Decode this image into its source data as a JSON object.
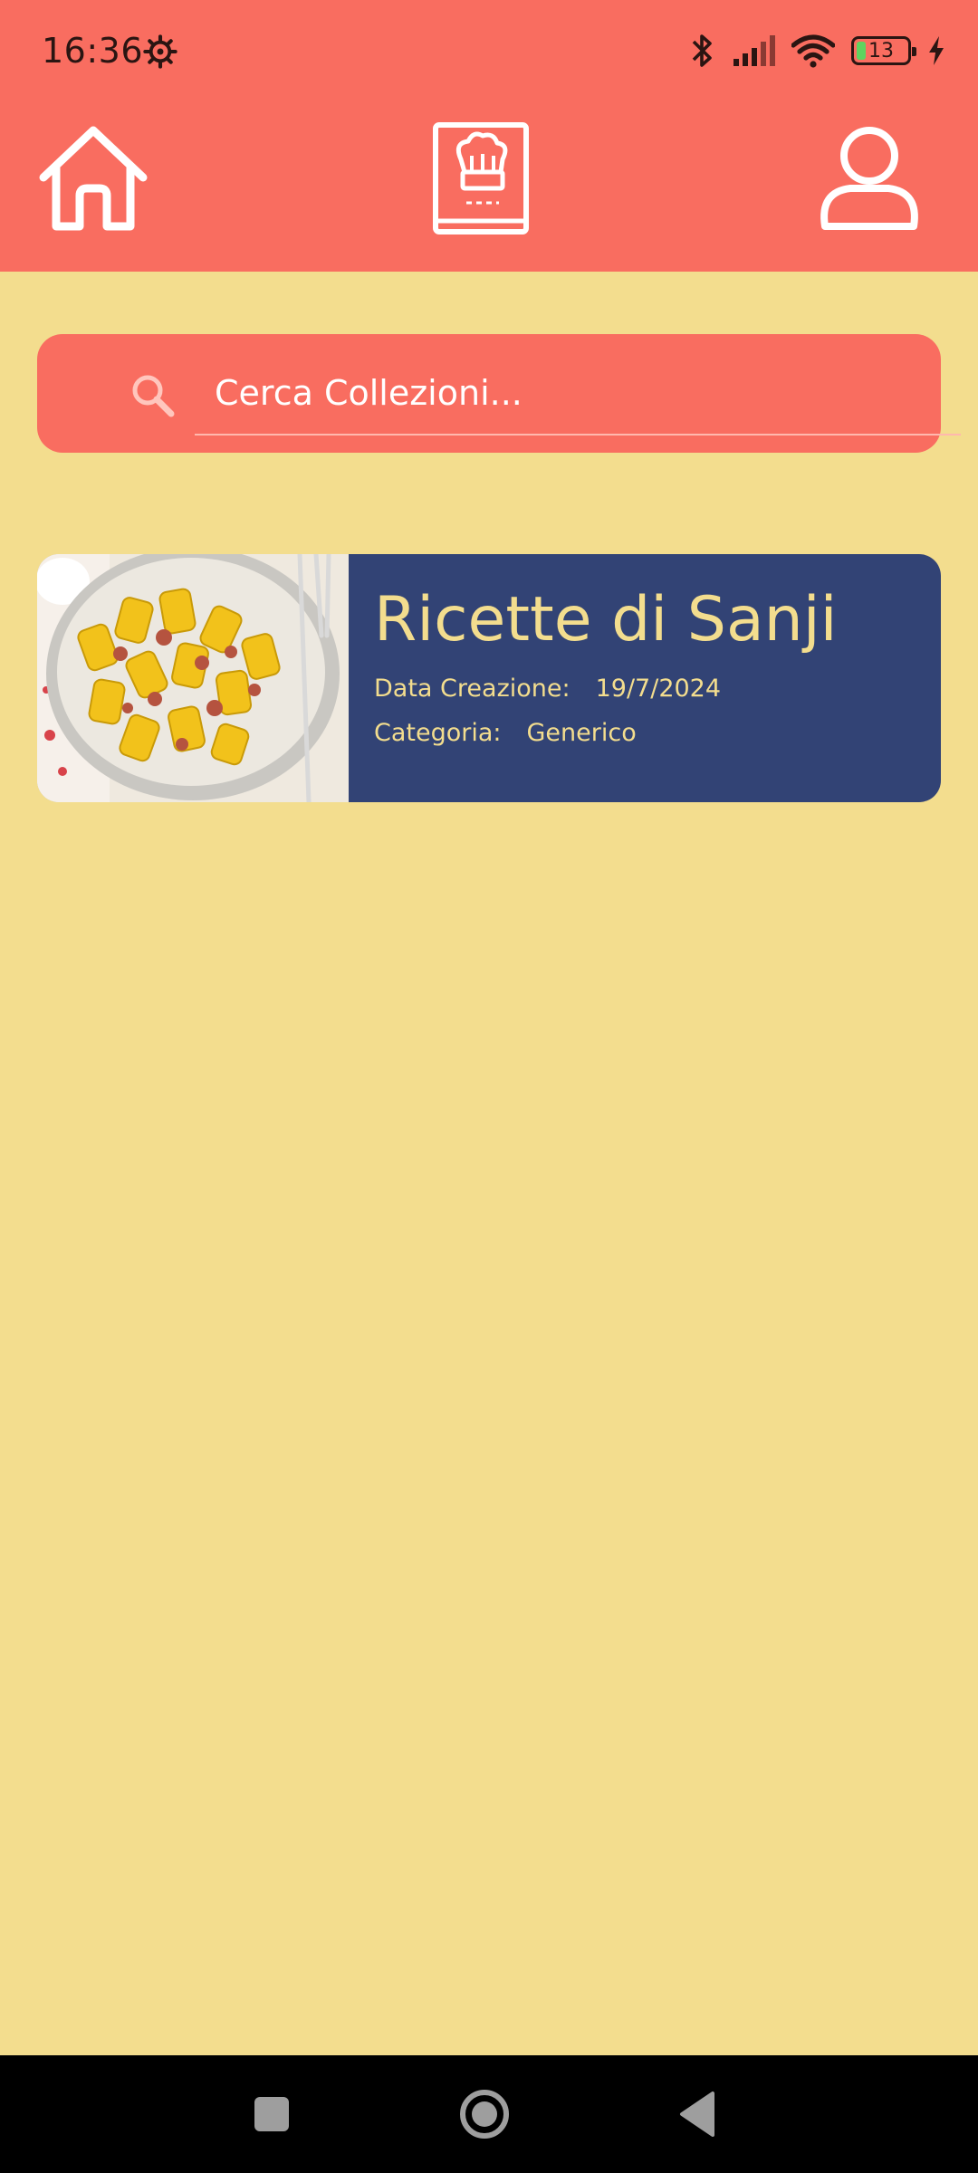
{
  "status_bar": {
    "time": "16:36",
    "battery_level": "13",
    "icons": [
      "settings-gear-icon",
      "bluetooth-icon",
      "signal-icon",
      "wifi-icon",
      "battery-icon",
      "charging-icon"
    ]
  },
  "nav": {
    "items": [
      {
        "icon": "home-icon"
      },
      {
        "icon": "recipe-book-icon"
      },
      {
        "icon": "profile-icon"
      }
    ]
  },
  "search": {
    "placeholder": "Cerca Collezioni..."
  },
  "collections": [
    {
      "title": "Ricette di Sanji",
      "date_label": "Data Creazione:",
      "date_value": "19/7/2024",
      "category_label": "Categoria:",
      "category_value": "Generico",
      "image": "pasta-dish-photo"
    }
  ],
  "colors": {
    "header": "#F96D60",
    "background": "#F3DD8E",
    "card": "#324375",
    "card_text": "#F3DD8E",
    "nav_icons": "#FFFFFF"
  }
}
